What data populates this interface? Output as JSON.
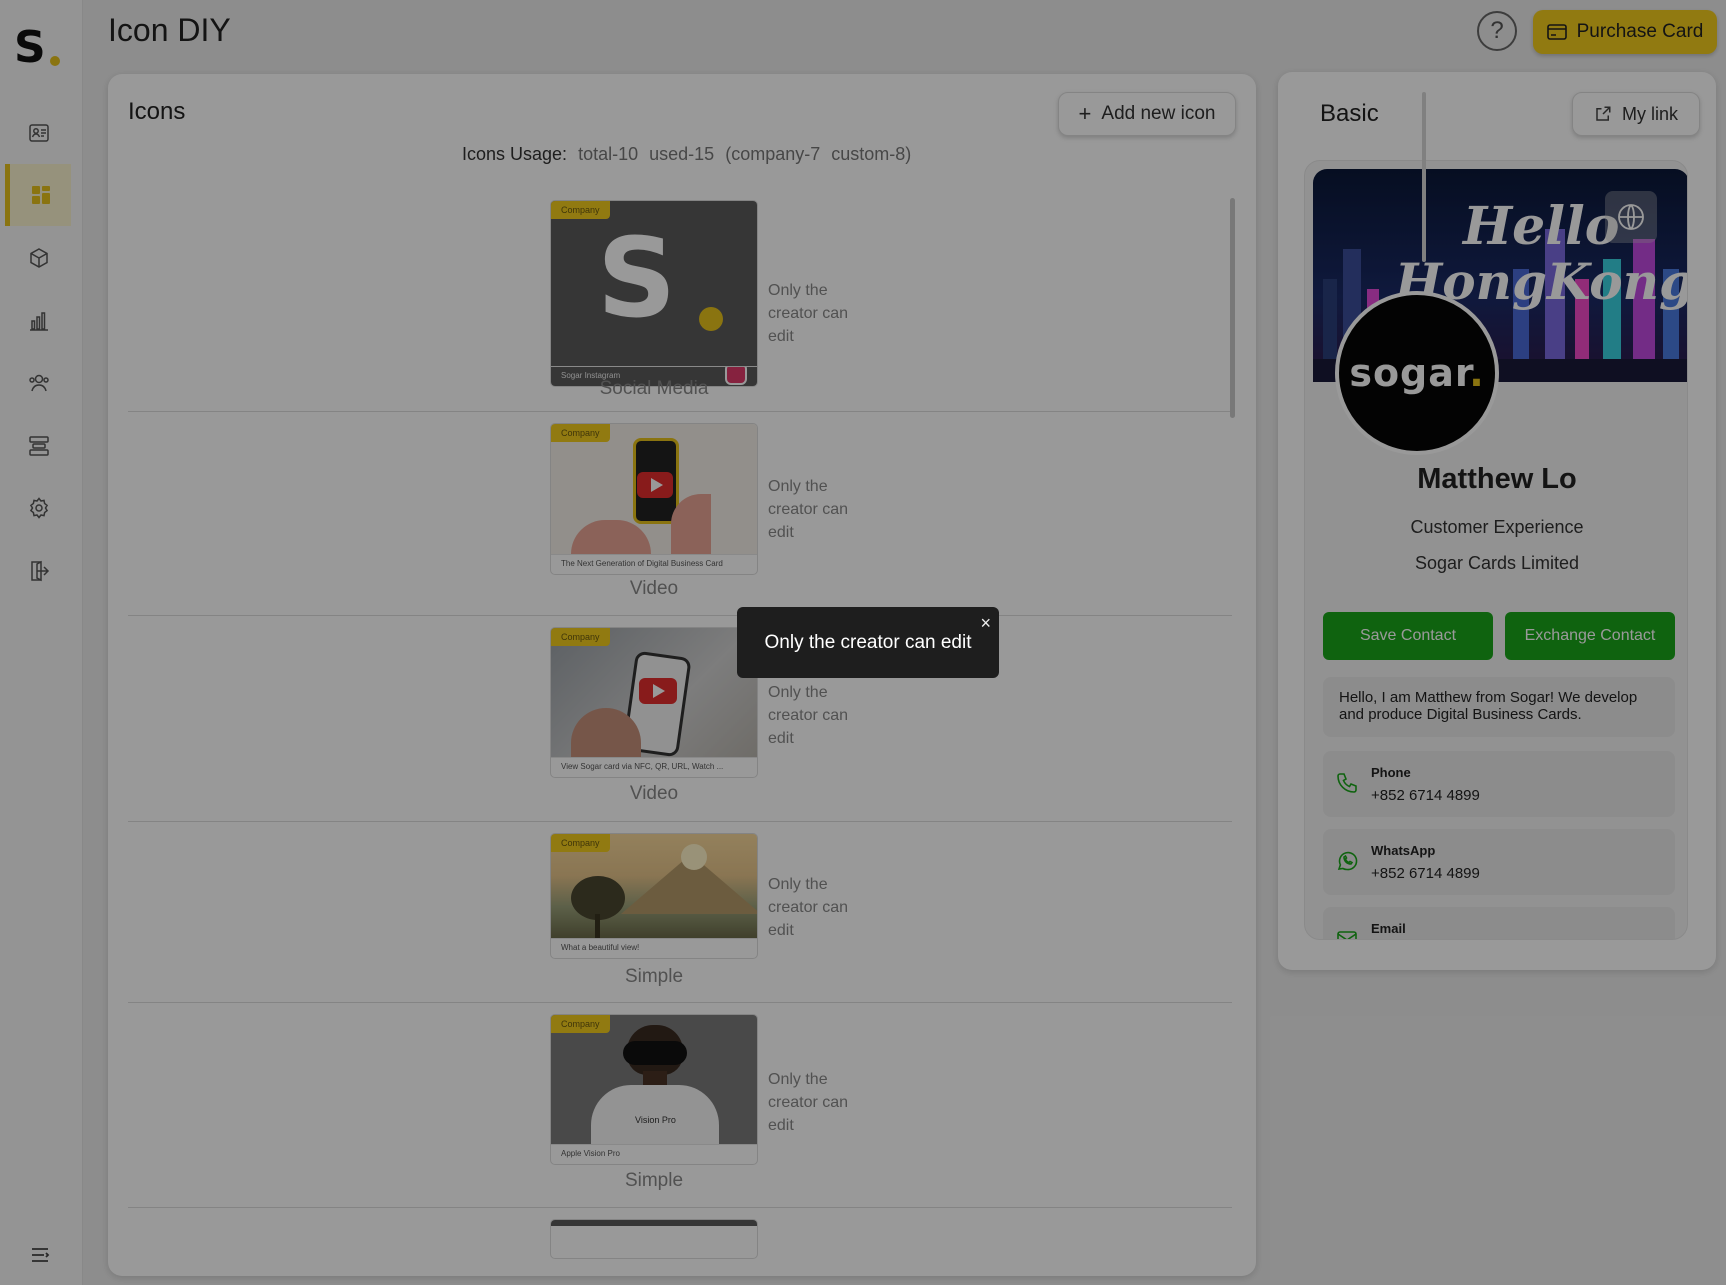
{
  "header": {
    "title": "Icon DIY",
    "help_label": "?",
    "purchase_label": "Purchase Card"
  },
  "icons_panel": {
    "title": "Icons",
    "add_label": "Add new icon",
    "usage_label": "Icons Usage:",
    "usage_total": "total-10",
    "usage_used": "used-15",
    "usage_company": "(company-7",
    "usage_custom": "custom-8)",
    "items": [
      {
        "badge": "Company",
        "caption": "Sogar Instagram",
        "type": "Social Media",
        "note": "Only the creator can edit"
      },
      {
        "badge": "Company",
        "caption": "The Next Generation of Digital Business Card",
        "type": "Video",
        "note": "Only the creator can edit"
      },
      {
        "badge": "Company",
        "caption": "View Sogar card via NFC, QR, URL, Watch ...",
        "type": "Video",
        "note": "Only the creator can edit"
      },
      {
        "badge": "Company",
        "caption": "What a beautiful view!",
        "type": "Simple",
        "note": "Only the creator can edit"
      },
      {
        "badge": "Company",
        "caption": "Apple Vision Pro",
        "type": "Simple",
        "note": "Only the creator can edit",
        "image_text": "Vision Pro"
      }
    ]
  },
  "tooltip": {
    "text": "Only the creator can edit",
    "close": "×"
  },
  "basic_panel": {
    "title": "Basic",
    "mylink_label": "My link",
    "card": {
      "banner_line1": "Hello",
      "banner_line2": "HongKong",
      "avatar_text": "sogar",
      "avatar_dot": ".",
      "name": "Matthew Lo",
      "role": "Customer Experience",
      "company": "Sogar Cards Limited",
      "save_label": "Save Contact",
      "exchange_label": "Exchange Contact",
      "bio": "Hello, I am Matthew from Sogar! We develop and produce Digital Business Cards.",
      "contacts": [
        {
          "label": "Phone",
          "value": "+852 6714 4899",
          "icon": "phone-icon"
        },
        {
          "label": "WhatsApp",
          "value": "+852 6714 4899",
          "icon": "whatsapp-icon"
        },
        {
          "label": "Email",
          "value": "",
          "icon": "email-icon"
        }
      ]
    }
  },
  "colors": {
    "accent": "#f2cb1d",
    "green": "#1aa61a",
    "overlay": "rgba(0,0,0,0.4)"
  }
}
